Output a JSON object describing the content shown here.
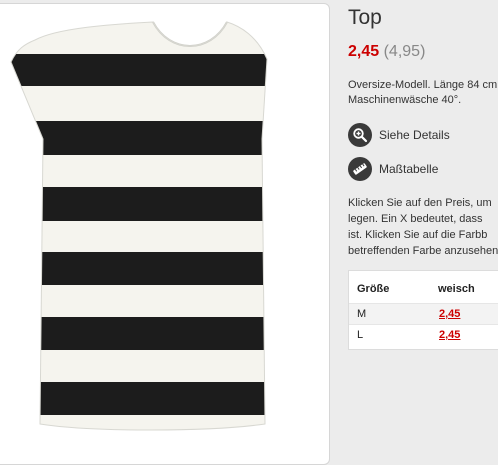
{
  "product": {
    "title": "Top",
    "price_current": "2,45",
    "price_original": "(4,95)",
    "description_lines": [
      "Oversize-Modell. Länge 84 cm.",
      "Maschinenwäsche 40°."
    ]
  },
  "actions": {
    "details_label": "Siehe Details",
    "size_chart_label": "Maßtabelle"
  },
  "instructions_lines": [
    "Klicken Sie auf den Preis, um",
    "legen. Ein X bedeutet, dass",
    "ist. Klicken Sie auf die Farbb",
    "betreffenden Farbe anzusehen"
  ],
  "size_table": {
    "headers": [
      "Größe",
      "weisch"
    ],
    "rows": [
      {
        "size": "M",
        "price": "2,45"
      },
      {
        "size": "L",
        "price": "2,45"
      }
    ]
  },
  "colors": {
    "price_red": "#cc0000",
    "stripe_dark": "#1c1c1c",
    "stripe_light": "#f5f4ee"
  },
  "icons": [
    "magnifier-plus-icon",
    "measuring-tape-icon"
  ]
}
